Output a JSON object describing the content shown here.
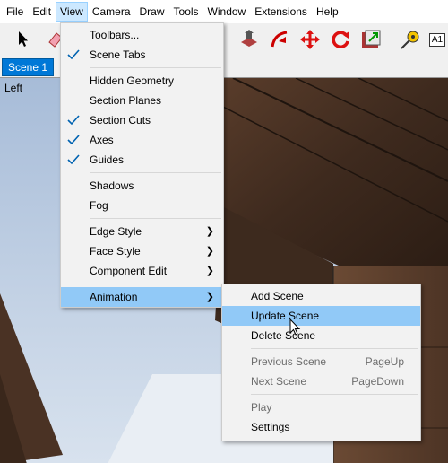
{
  "menubar": {
    "items": [
      "File",
      "Edit",
      "View",
      "Camera",
      "Draw",
      "Tools",
      "Window",
      "Extensions",
      "Help"
    ]
  },
  "toolbar": {
    "icons": [
      "select-icon",
      "eraser-icon",
      "push-pull-icon",
      "follow-me-icon",
      "move-icon",
      "rotate-icon",
      "scale-icon",
      "tape-measure-icon",
      "dimension-icon"
    ],
    "dimension_text": "A1"
  },
  "scenes": {
    "tabs": [
      "Scene 1"
    ]
  },
  "viewport": {
    "label": "Left"
  },
  "view_menu": {
    "items": [
      {
        "label": "Toolbars...",
        "checked": false
      },
      {
        "label": "Scene Tabs",
        "checked": true
      },
      {
        "label": "Hidden Geometry",
        "checked": false
      },
      {
        "label": "Section Planes",
        "checked": false
      },
      {
        "label": "Section Cuts",
        "checked": true
      },
      {
        "label": "Axes",
        "checked": true
      },
      {
        "label": "Guides",
        "checked": true
      },
      {
        "label": "Shadows",
        "checked": false
      },
      {
        "label": "Fog",
        "checked": false
      },
      {
        "label": "Edge Style",
        "checked": false
      },
      {
        "label": "Face Style",
        "checked": false
      },
      {
        "label": "Component Edit",
        "checked": false
      },
      {
        "label": "Animation",
        "checked": false
      }
    ]
  },
  "animation_menu": {
    "items": [
      {
        "label": "Add Scene",
        "shortcut": ""
      },
      {
        "label": "Update Scene",
        "shortcut": ""
      },
      {
        "label": "Delete Scene",
        "shortcut": ""
      },
      {
        "label": "Previous Scene",
        "shortcut": "PageUp"
      },
      {
        "label": "Next Scene",
        "shortcut": "PageDown"
      },
      {
        "label": "Play",
        "shortcut": ""
      },
      {
        "label": "Settings",
        "shortcut": ""
      }
    ]
  },
  "colors": {
    "accent": "#0078d7",
    "menu_highlight": "#91c9f7",
    "check": "#0063b1",
    "wood": "#4a3224",
    "sky": "#b9cde6"
  }
}
